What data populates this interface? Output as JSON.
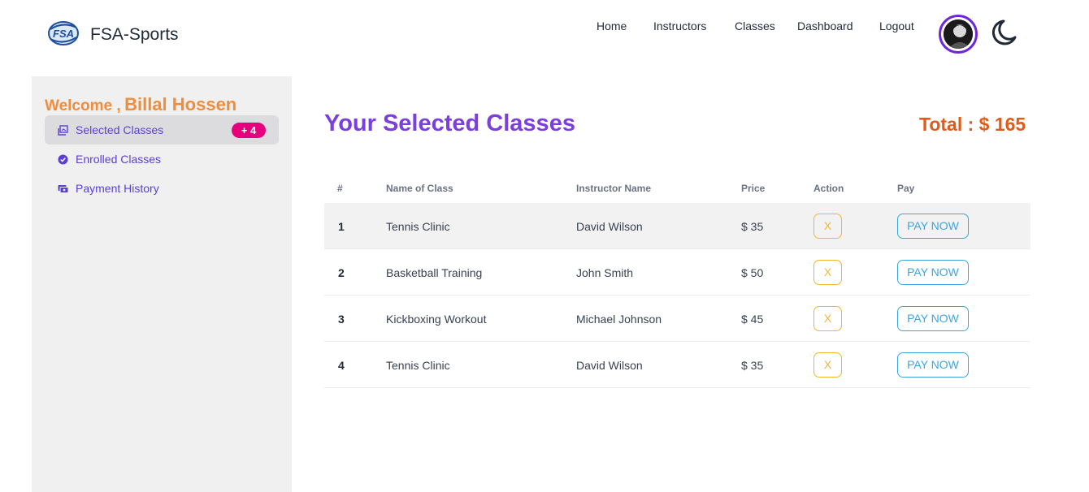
{
  "app": {
    "brand": "FSA-Sports",
    "logo_text": "FSA"
  },
  "nav": {
    "items": [
      "Home",
      "Instructors",
      "Classes",
      "Dashboard",
      "Logout"
    ]
  },
  "sidebar": {
    "welcome_label": "Welcome ,",
    "user_name": "Billal Hossen",
    "items": [
      {
        "label": "Selected Classes",
        "icon": "collection-icon",
        "badge": "+ 4",
        "active": true
      },
      {
        "label": "Enrolled Classes",
        "icon": "check-circle-icon",
        "active": false
      },
      {
        "label": "Payment History",
        "icon": "payment-icon",
        "active": false
      }
    ]
  },
  "main": {
    "title": "Your Selected Classes",
    "total": "Total : $ 165",
    "table": {
      "headers": [
        "#",
        "Name of Class",
        "Instructor Name",
        "Price",
        "Action",
        "Pay"
      ],
      "rows": [
        {
          "num": "1",
          "name": "Tennis Clinic",
          "instructor": "David Wilson",
          "price": "$ 35",
          "action": "X",
          "pay": "PAY NOW"
        },
        {
          "num": "2",
          "name": "Basketball Training",
          "instructor": "John Smith",
          "price": "$ 50",
          "action": "X",
          "pay": "PAY NOW"
        },
        {
          "num": "3",
          "name": "Kickboxing Workout",
          "instructor": "Michael Johnson",
          "price": "$ 45",
          "action": "X",
          "pay": "PAY NOW"
        },
        {
          "num": "4",
          "name": "Tennis Clinic",
          "instructor": "David Wilson",
          "price": "$ 35",
          "action": "X",
          "pay": "PAY NOW"
        }
      ]
    }
  },
  "colors": {
    "accent_purple": "#7a3fdc",
    "welcome_orange": "#f18c3a",
    "total_orange": "#e05b1a",
    "badge_pink": "#e6007e",
    "action_yellow": "#f6b431",
    "pay_blue": "#3aa6e0"
  }
}
